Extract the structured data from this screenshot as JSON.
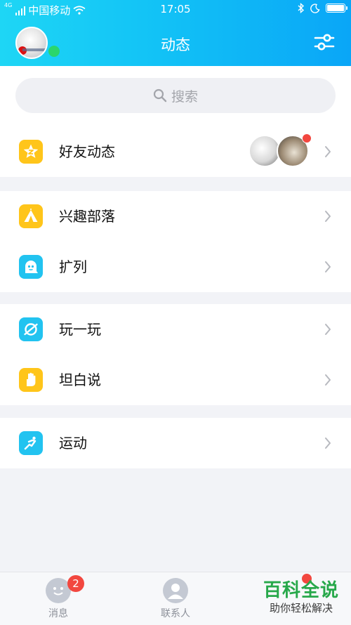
{
  "status_bar": {
    "network": "4G",
    "carrier": "中国移动",
    "time": "17:05"
  },
  "header": {
    "title": "动态"
  },
  "search": {
    "label": "搜索"
  },
  "sections": [
    [
      {
        "label": "好友动态",
        "icon": "qzone-star-icon"
      }
    ],
    [
      {
        "label": "兴趣部落",
        "icon": "tent-icon"
      },
      {
        "label": "扩列",
        "icon": "ghost-face-icon"
      }
    ],
    [
      {
        "label": "玩一玩",
        "icon": "planet-icon"
      },
      {
        "label": "坦白说",
        "icon": "hand-icon"
      }
    ],
    [
      {
        "label": "运动",
        "icon": "runner-icon"
      }
    ]
  ],
  "tabbar": {
    "messages": {
      "label": "消息",
      "badge": "2"
    },
    "contacts": {
      "label": "联系人"
    }
  },
  "watermark": {
    "title": "百科全说",
    "subtitle": "助你轻松解决"
  },
  "colors": {
    "header_start": "#1ed6f5",
    "header_end": "#0aa6f7",
    "icon_yellow": "#ffc51a",
    "icon_cyan": "#22c3f0",
    "badge_red": "#f2473f",
    "online_green": "#2bd66c",
    "watermark_green": "#27a84a"
  }
}
